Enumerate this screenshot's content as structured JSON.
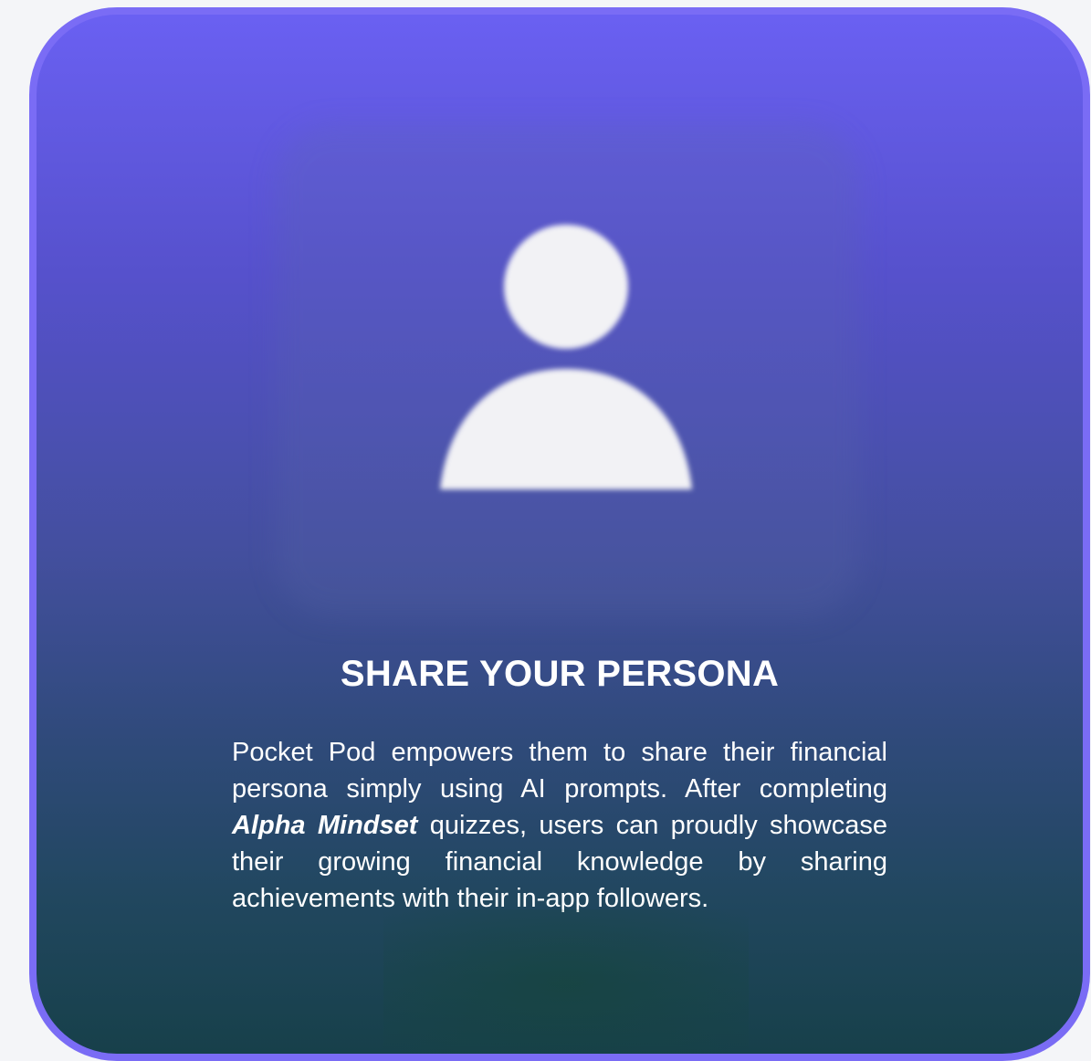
{
  "card": {
    "title": "SHARE YOUR PERSONA",
    "body": {
      "before": "Pocket Pod empowers them to share their financial persona simply using AI prompts. After completing ",
      "highlight": "Alpha Mindset",
      "after": " quizzes, users can proudly showcase their growing financial knowledge by sharing achievements with their in-app followers."
    },
    "icon": "user-avatar-icon"
  },
  "colors": {
    "border": "#7a6cf5",
    "gradient_top": "#6a60f2",
    "gradient_bottom": "#17404a",
    "text": "#ffffff"
  }
}
